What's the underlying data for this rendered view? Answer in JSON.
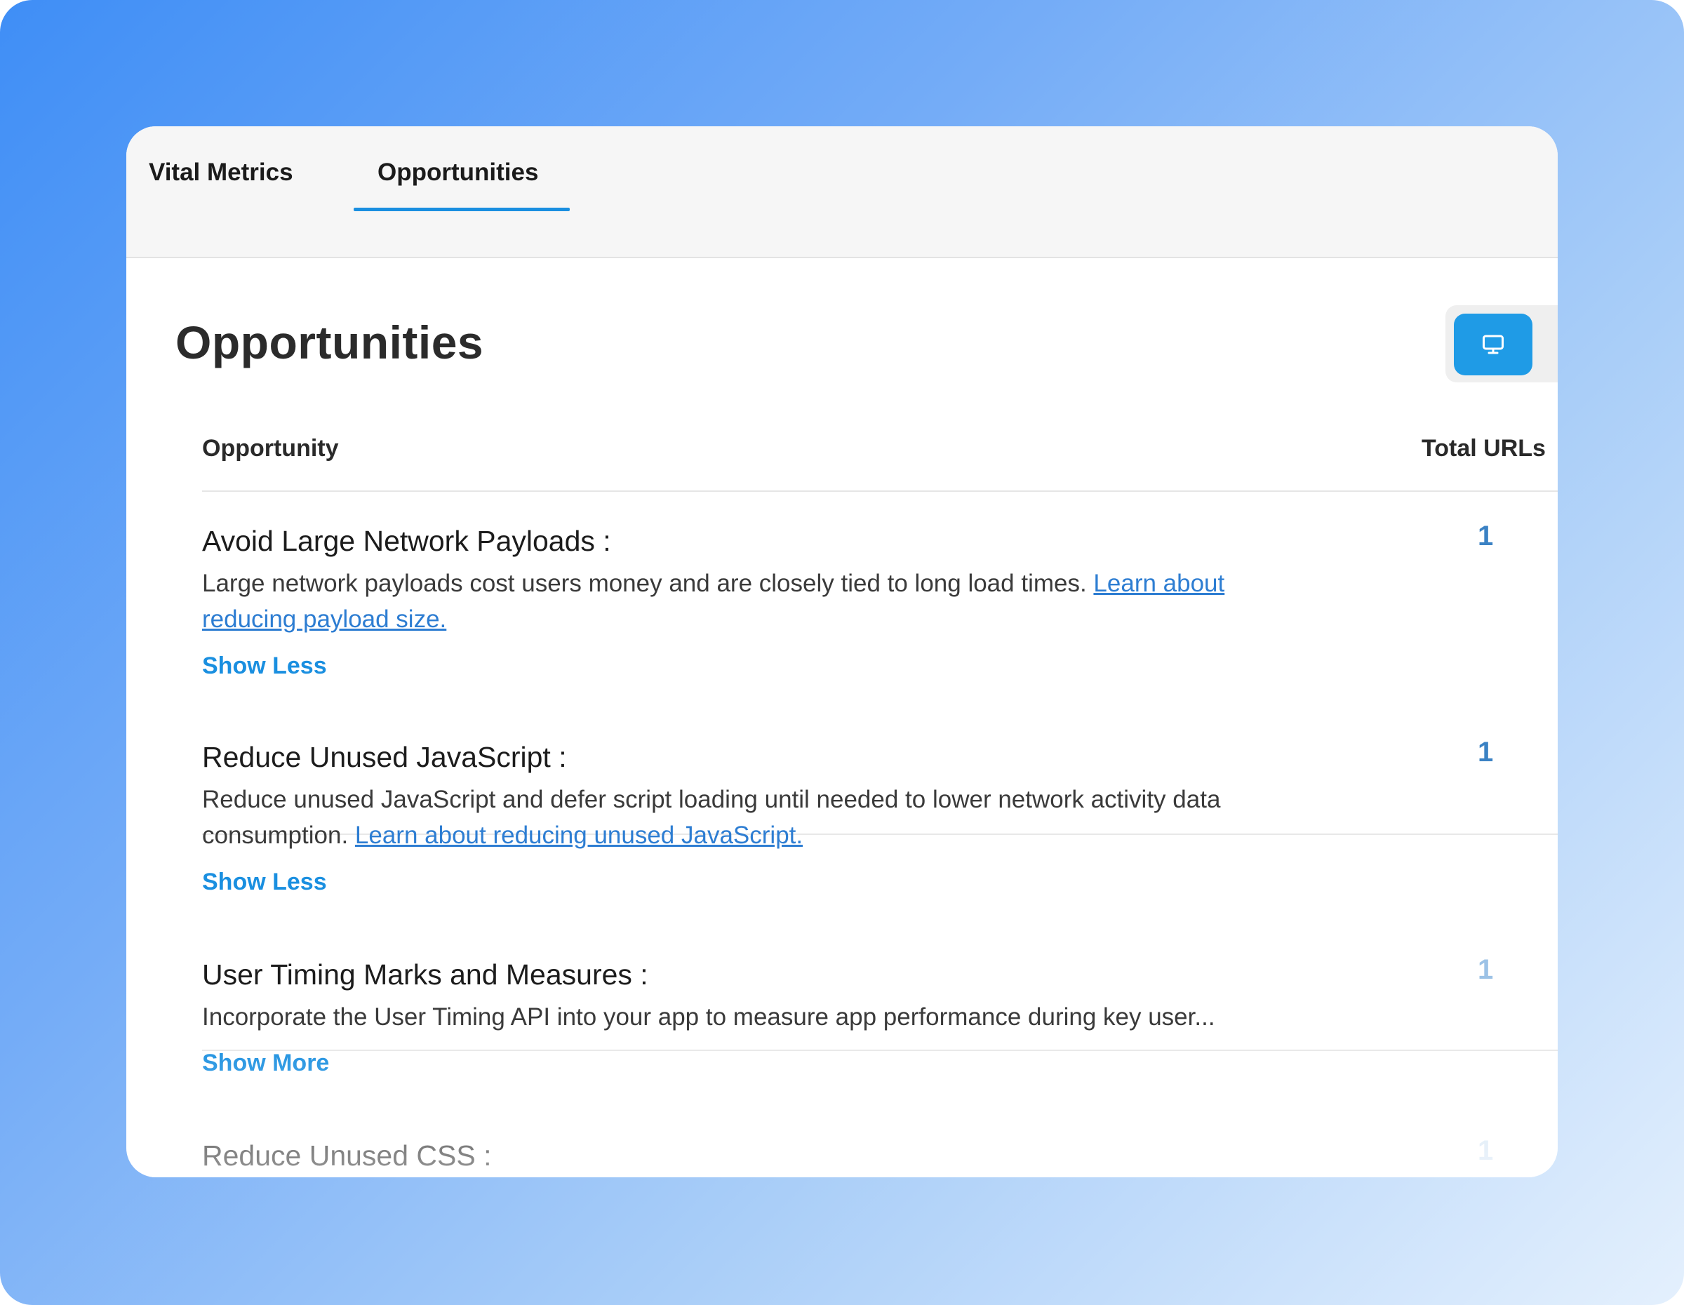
{
  "tabs": [
    {
      "label": "Vital Metrics",
      "active": false
    },
    {
      "label": "Opportunities",
      "active": true
    }
  ],
  "page_title": "Opportunities",
  "device_toggle": {
    "selected": "desktop",
    "icon": "monitor-icon"
  },
  "table": {
    "columns": [
      "Opportunity",
      "Total URLs"
    ],
    "rows": [
      {
        "title": "Avoid Large Network Payloads :",
        "description": "Large network payloads cost users money and are closely tied to long load times. ",
        "link": "Learn about reducing payload size.",
        "toggle": "Show Less",
        "count": "1"
      },
      {
        "title": "Reduce Unused JavaScript :",
        "description": "Reduce unused JavaScript and defer script loading until needed to lower network activity data consumption. ",
        "link": "Learn about reducing unused JavaScript.",
        "toggle": "Show Less",
        "count": "1"
      },
      {
        "title": "User Timing Marks and Measures :",
        "description": "Incorporate the User Timing API into your app to measure app performance during key user...",
        "toggle": "Show More",
        "count": "1"
      },
      {
        "title": "Reduce Unused CSS :",
        "count": "1"
      }
    ]
  },
  "colors": {
    "accent": "#1a8fe0",
    "link": "#2d7dd2",
    "count": "#3b82c4",
    "device_button": "#1f9be6"
  }
}
